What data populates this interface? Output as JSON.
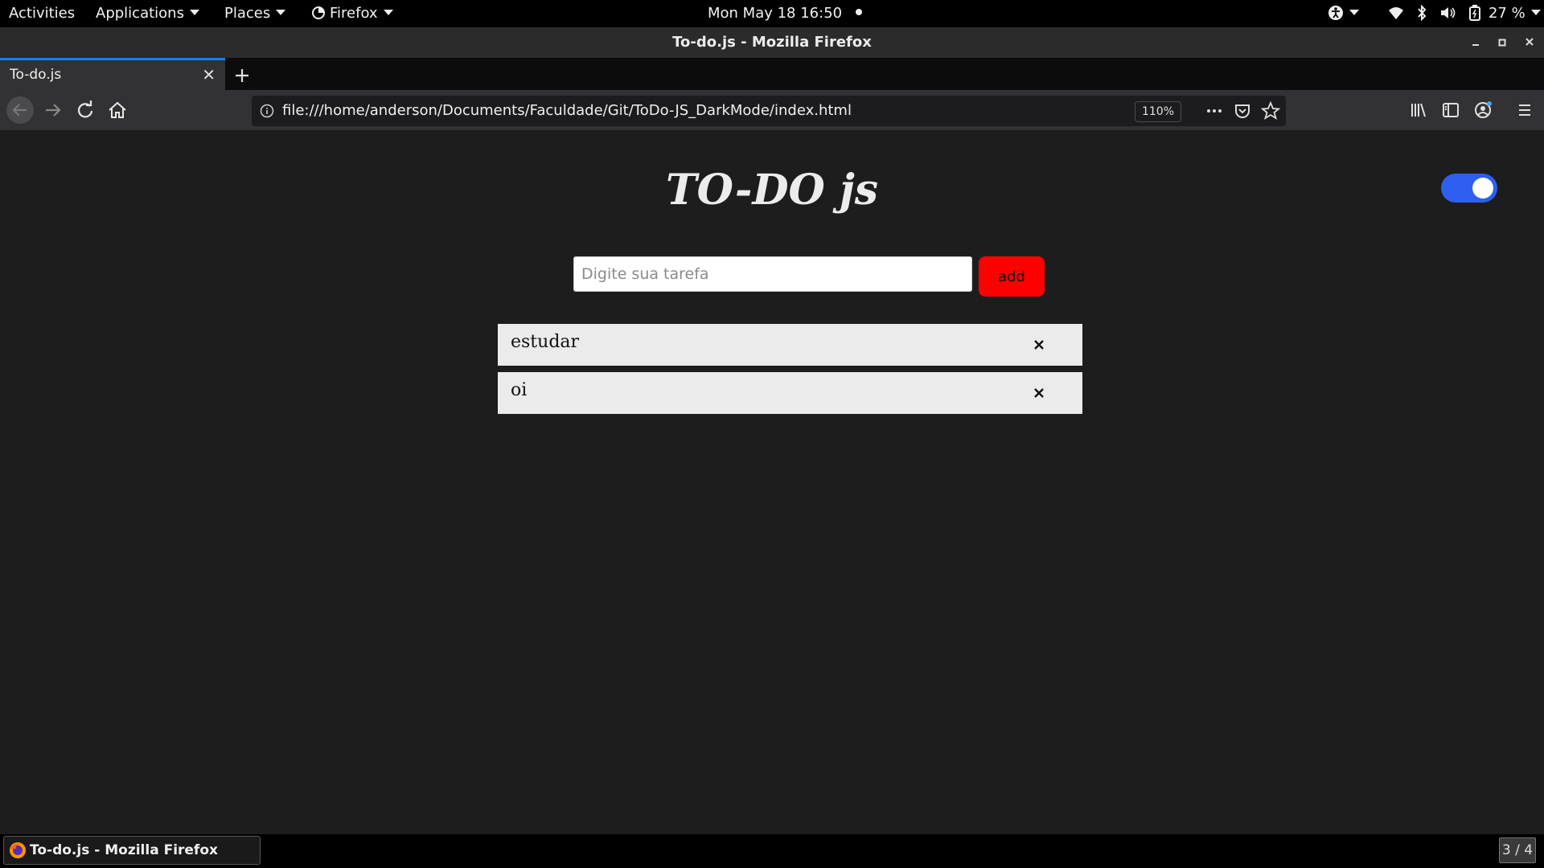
{
  "topbar": {
    "activities": "Activities",
    "applications": "Applications",
    "places": "Places",
    "firefox": "Firefox",
    "clock": "Mon May 18  16:50",
    "battery": "27 %"
  },
  "window": {
    "title": "To-do.js - Mozilla Firefox"
  },
  "tab": {
    "label": "To-do.js"
  },
  "navbar": {
    "url": "file:///home/anderson/Documents/Faculdade/Git/ToDo-JS_DarkMode/index.html",
    "zoom": "110%"
  },
  "app": {
    "title": "TO-DO js",
    "input_placeholder": "Digite sua tarefa",
    "add_label": "add",
    "toggle_on": true,
    "tasks": [
      {
        "text": "estudar"
      },
      {
        "text": "oi"
      }
    ]
  },
  "taskbar": {
    "item": "To-do.js - Mozilla Firefox",
    "workspace": "3 / 4"
  },
  "colors": {
    "page_bg": "#1d1d1d",
    "add_button": "#ff0000",
    "toggle": "#2e5ff0",
    "task_bg": "#ebebeb"
  }
}
